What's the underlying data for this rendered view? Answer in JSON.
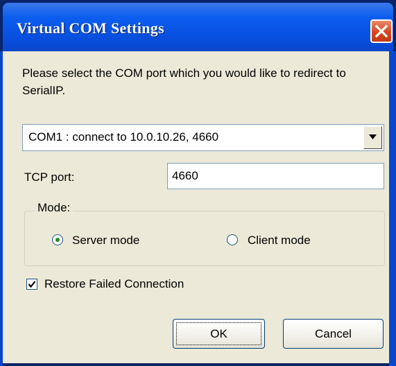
{
  "window": {
    "title": "Virtual COM Settings"
  },
  "instruction": "Please select the COM port which you  would like to redirect to SerialIP.",
  "com_port": {
    "selected": "COM1 : connect to 10.0.10.26, 4660"
  },
  "tcp_port": {
    "label": "TCP port:",
    "value": "4660"
  },
  "mode": {
    "label": "Mode:",
    "options": [
      {
        "label": "Server mode",
        "selected": true
      },
      {
        "label": "Client mode",
        "selected": false
      }
    ]
  },
  "restore": {
    "label": "Restore Failed Connection",
    "checked": true
  },
  "buttons": {
    "ok": "OK",
    "cancel": "Cancel"
  },
  "colors": {
    "title_bar": "#0a5ef0",
    "close_button": "#d8461f",
    "dialog_face": "#ece9d8",
    "radio_dot": "#1e8b1e"
  }
}
